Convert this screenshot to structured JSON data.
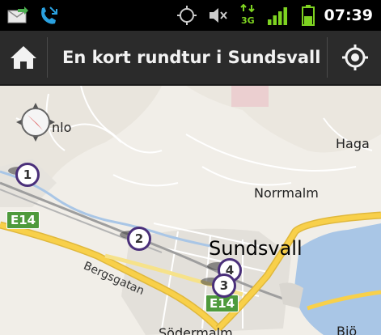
{
  "status_bar": {
    "time": "07:39",
    "network_type": "3G",
    "icons": [
      "message-icon",
      "missed-call-icon",
      "gps-icon",
      "mute-icon",
      "network-3g-icon",
      "signal-icon",
      "battery-icon"
    ],
    "signal_bars": 4,
    "battery_level": 0.5
  },
  "action_bar": {
    "title": "En kort rundtur i Sundsvall",
    "home_icon": "home-icon",
    "locate_icon": "my-location-icon"
  },
  "map": {
    "places": {
      "haga": "Haga",
      "norrmalm": "Norrmalm",
      "sundsvall": "Sundsvall",
      "nlo": "nlo",
      "sodermalm": "Södermalm",
      "bjorn": "Bjö"
    },
    "roads": {
      "bergsgatan": "Bergsgatan",
      "e14_west": "E14",
      "e14_center": "E14"
    },
    "markers": [
      "1",
      "2",
      "3",
      "4"
    ],
    "compass_icon": "compass-icon",
    "colors": {
      "land": "#f1eee8",
      "water": "#a9c6e6",
      "highway": "#f8d04a",
      "marker_border": "#4a2f7a",
      "shield": "#4e9a3c"
    }
  }
}
